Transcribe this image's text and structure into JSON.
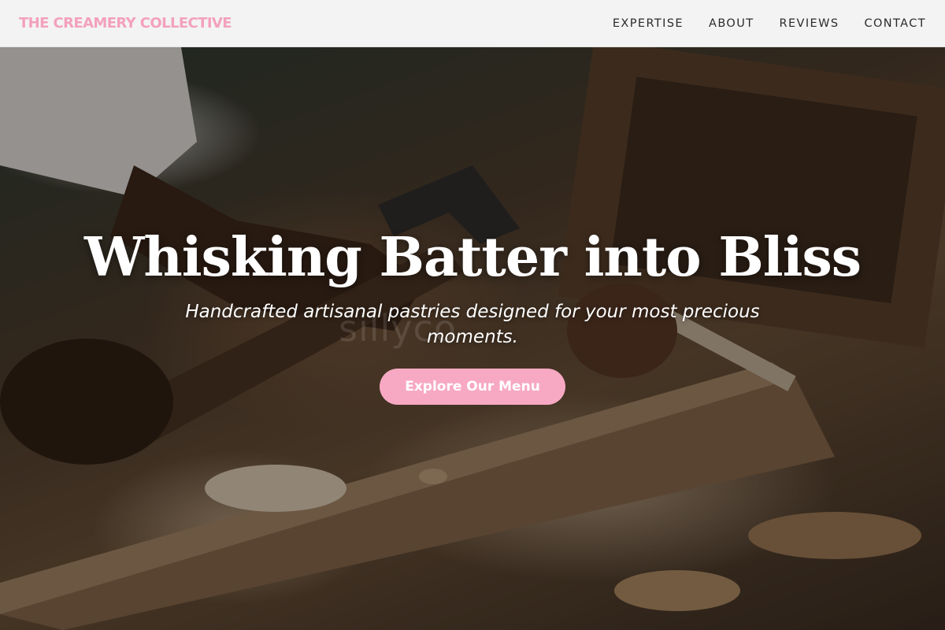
{
  "header": {
    "brand": "THE CREAMERY COLLECTIVE",
    "nav": [
      {
        "label": "EXPERTISE"
      },
      {
        "label": "ABOUT"
      },
      {
        "label": "REVIEWS"
      },
      {
        "label": "CONTACT"
      }
    ]
  },
  "hero": {
    "title": "Whisking Batter into Bliss",
    "subtitle": "Handcrafted artisanal pastries designed for your most precious moments.",
    "cta_label": "Explore Our Menu",
    "background_photo": "woodcarver-with-chisel-and-hammer-photo",
    "watermark": "sillyco"
  },
  "colors": {
    "brand_pink": "#f3a1bd",
    "cta_pink": "#f7a9c3",
    "header_bg": "#f3f3f3",
    "nav_text": "#2b2b2b"
  }
}
